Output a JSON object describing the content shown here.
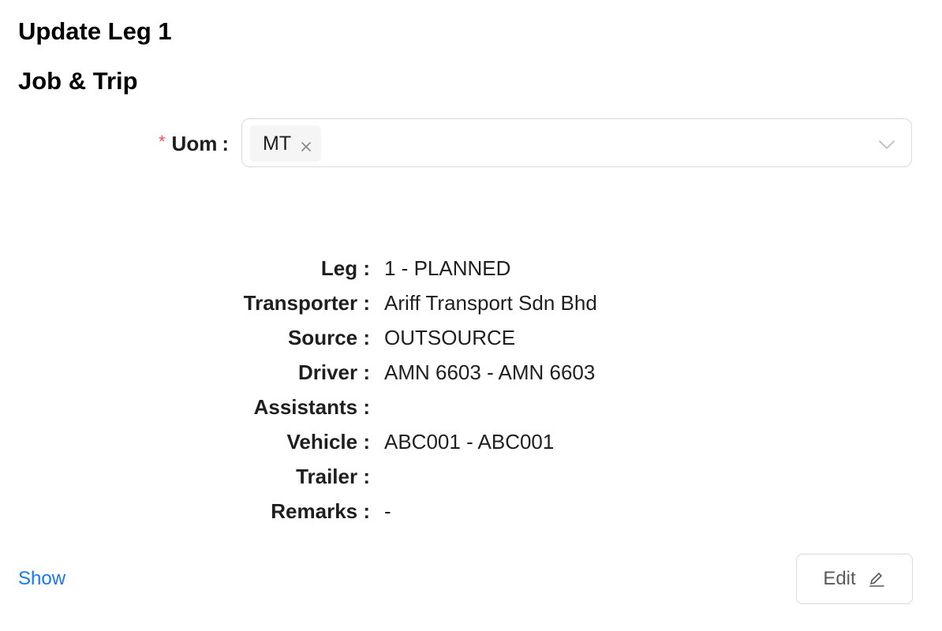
{
  "header": {
    "title": "Update Leg 1",
    "section_title": "Job & Trip"
  },
  "form": {
    "uom": {
      "required_mark": "*",
      "label": "Uom",
      "colon": ":",
      "selected_tags": [
        "MT"
      ]
    }
  },
  "details": {
    "rows": [
      {
        "label": "Leg :",
        "value": "1 - PLANNED"
      },
      {
        "label": "Transporter :",
        "value": "Ariff Transport Sdn Bhd"
      },
      {
        "label": "Source :",
        "value": "OUTSOURCE"
      },
      {
        "label": "Driver :",
        "value": "AMN 6603 - AMN 6603"
      },
      {
        "label": "Assistants :",
        "value": ""
      },
      {
        "label": "Vehicle :",
        "value": "ABC001 - ABC001"
      },
      {
        "label": "Trailer :",
        "value": ""
      },
      {
        "label": "Remarks :",
        "value": "-"
      }
    ]
  },
  "actions": {
    "show_label": "Show",
    "edit_label": "Edit"
  },
  "icons": {
    "tag_close": "close-icon",
    "select_arrow": "chevron-down-icon",
    "edit": "pencil-icon"
  },
  "colors": {
    "required": "#ff4d4f",
    "link": "#1677ff",
    "border": "#d9d9d9",
    "tag_bg": "#f5f5f5"
  }
}
